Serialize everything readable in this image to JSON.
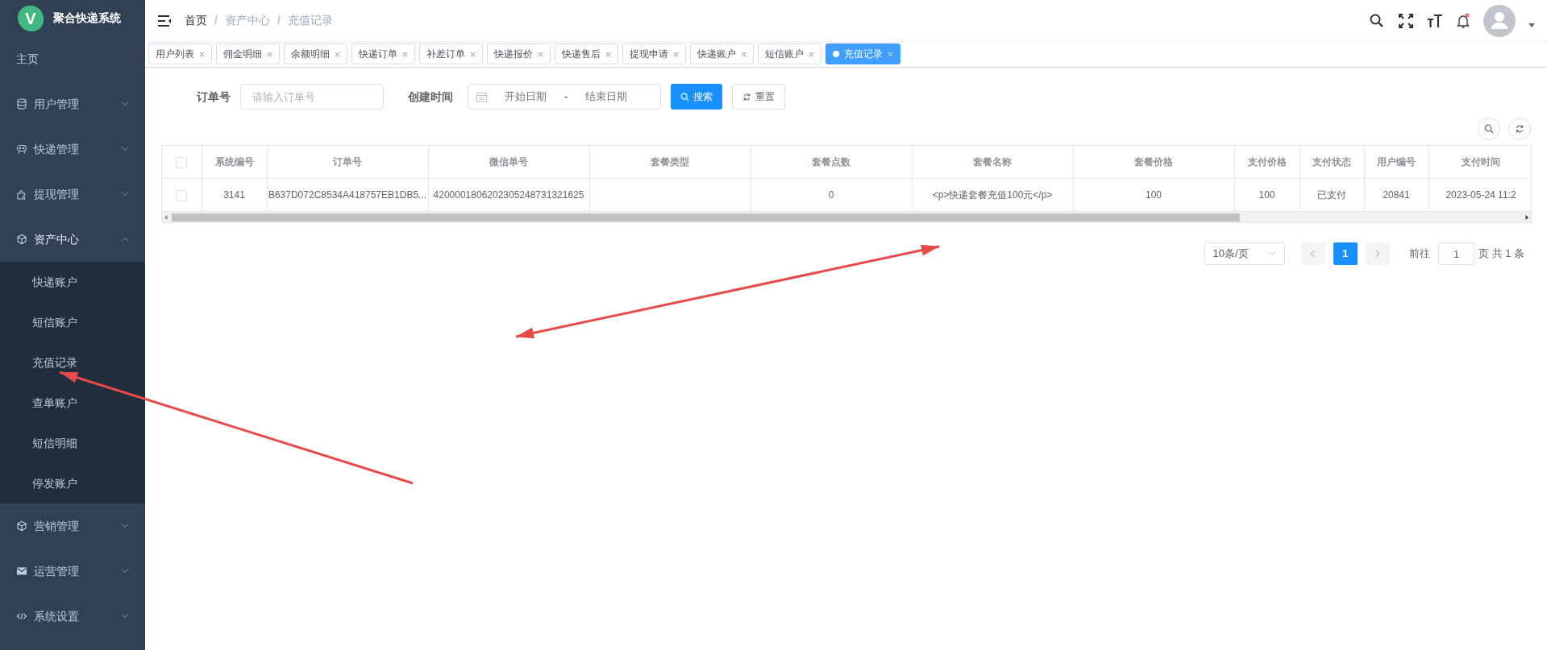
{
  "sidebar": {
    "app_name": "聚合快递系统",
    "logo_letter": "V",
    "items": [
      {
        "label": "主页",
        "kind": "plain"
      },
      {
        "label": "用户管理",
        "kind": "group",
        "expanded": false
      },
      {
        "label": "快递管理",
        "kind": "group",
        "expanded": false
      },
      {
        "label": "提现管理",
        "kind": "group",
        "expanded": false
      },
      {
        "label": "资产中心",
        "kind": "group",
        "expanded": true,
        "children": [
          {
            "label": "快递账户"
          },
          {
            "label": "短信账户"
          },
          {
            "label": "充值记录"
          },
          {
            "label": "查单账户"
          },
          {
            "label": "短信明细"
          },
          {
            "label": "停发账户"
          }
        ]
      },
      {
        "label": "营销管理",
        "kind": "group",
        "expanded": false
      },
      {
        "label": "运营管理",
        "kind": "group",
        "expanded": false
      },
      {
        "label": "系统设置",
        "kind": "group",
        "expanded": false
      }
    ]
  },
  "header": {
    "breadcrumb": [
      "首页",
      "资产中心",
      "充值记录"
    ],
    "breadcrumb_separator": "/",
    "notification_dot": true
  },
  "tabs": [
    {
      "label": "用户列表",
      "selected": false
    },
    {
      "label": "佣金明细",
      "selected": false
    },
    {
      "label": "余额明细",
      "selected": false
    },
    {
      "label": "快递订单",
      "selected": false
    },
    {
      "label": "补差订单",
      "selected": false
    },
    {
      "label": "快递报价",
      "selected": false
    },
    {
      "label": "快递售后",
      "selected": false
    },
    {
      "label": "提现申请",
      "selected": false
    },
    {
      "label": "快递账户",
      "selected": false
    },
    {
      "label": "短信账户",
      "selected": false
    },
    {
      "label": "充值记录",
      "selected": true
    }
  ],
  "search": {
    "order_label": "订单号",
    "order_placeholder": "请输入订单号",
    "time_label": "创建时间",
    "start_placeholder": "开始日期",
    "separator": "-",
    "end_placeholder": "结束日期",
    "search_button": "搜索",
    "reset_button": "重置"
  },
  "table": {
    "select_all_checked": false,
    "columns": [
      "系统编号",
      "订单号",
      "微信单号",
      "套餐类型",
      "套餐点数",
      "套餐名称",
      "套餐价格",
      "支付价格",
      "支付状态",
      "用户编号",
      "支付时间"
    ],
    "rows": [
      {
        "checked": false,
        "cells": [
          "3141",
          "B637D072C8534A418757EB1DB5...",
          "4200001806202305248731321625",
          "",
          "0",
          "<p>快递套餐充值100元</p>",
          "100",
          "100",
          "已支付",
          "20841",
          "2023-05-24 11:2"
        ]
      }
    ]
  },
  "pagination": {
    "page_size": "10条/页",
    "pages": [
      {
        "label": "1",
        "selected": true
      }
    ],
    "goto_label": "前往",
    "goto_value": "1",
    "goto_suffix": "页",
    "total": "共 1 条"
  }
}
